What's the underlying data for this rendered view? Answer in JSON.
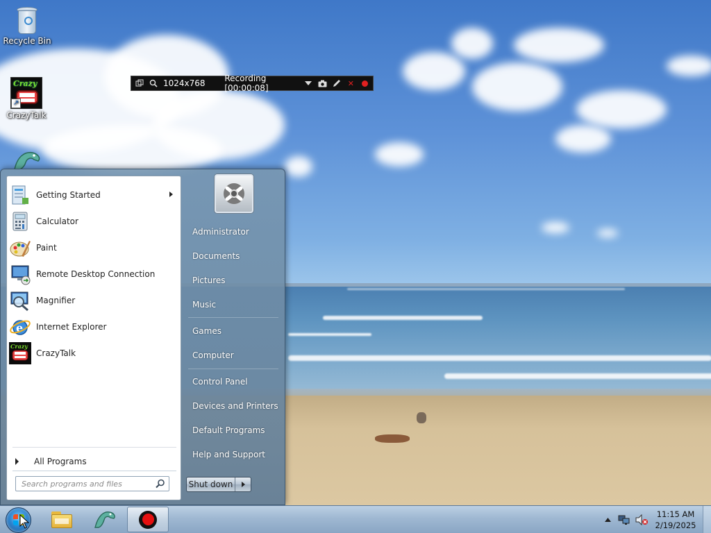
{
  "desktop": {
    "icons": [
      {
        "label": "Recycle Bin",
        "icon": "recycle-bin-icon"
      },
      {
        "label": "CrazyTalk",
        "icon": "crazytalk-icon"
      },
      {
        "label": "",
        "icon": "dragon-icon"
      }
    ]
  },
  "recorder": {
    "resolution": "1024x768",
    "status": "Recording [00:00:08]"
  },
  "start_menu": {
    "programs": [
      {
        "label": "Getting Started",
        "icon": "getting-started-icon",
        "has_submenu": true
      },
      {
        "label": "Calculator",
        "icon": "calculator-icon"
      },
      {
        "label": "Paint",
        "icon": "paint-icon"
      },
      {
        "label": "Remote Desktop Connection",
        "icon": "remote-desktop-icon"
      },
      {
        "label": "Magnifier",
        "icon": "magnifier-icon"
      },
      {
        "label": "Internet Explorer",
        "icon": "internet-explorer-icon"
      },
      {
        "label": "CrazyTalk",
        "icon": "crazytalk-icon"
      }
    ],
    "all_programs_label": "All Programs",
    "search_placeholder": "Search programs and files",
    "right_items": [
      "Administrator",
      "Documents",
      "Pictures",
      "Music",
      "Games",
      "Computer",
      "Control Panel",
      "Devices and Printers",
      "Default Programs",
      "Help and Support"
    ],
    "shutdown_label": "Shut down"
  },
  "taskbar": {
    "pinned": [
      "windows-explorer-icon",
      "dragon-icon",
      "recorder-icon"
    ],
    "clock": {
      "time": "11:15 AM",
      "date": "2/19/2025"
    }
  },
  "colors": {
    "recorder_accent": "#e02020",
    "taskbar_top": "#bcd0e4",
    "start_menu_right": "#7896af"
  }
}
